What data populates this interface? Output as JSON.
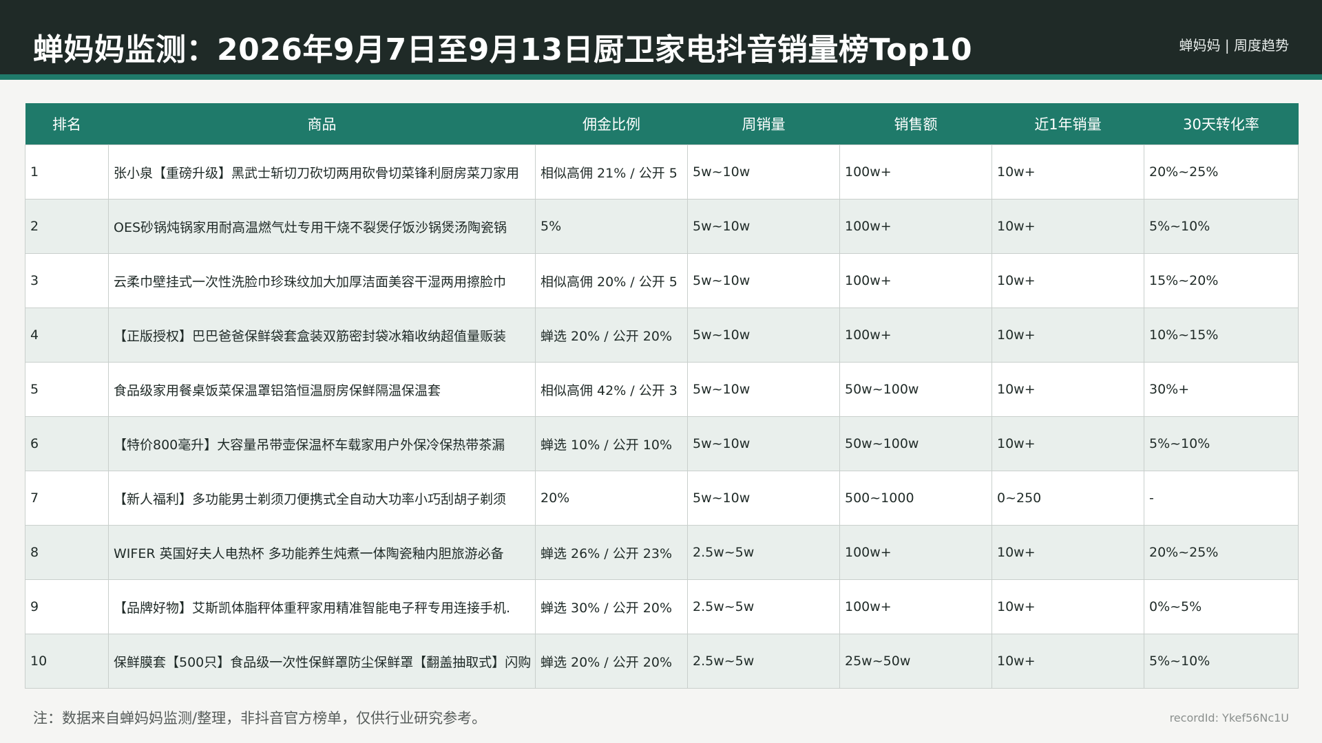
{
  "header": {
    "title": "蝉妈妈监测：2026年9月7日至9月13日厨卫家电抖音销量榜Top10",
    "brand": "蝉妈妈 | 周度趋势"
  },
  "table": {
    "columns": [
      "排名",
      "商品",
      "佣金比例",
      "周销量",
      "销售额",
      "近1年销量",
      "30天转化率"
    ],
    "rows": [
      {
        "rank": "1",
        "product": "张小泉【重磅升级】黑武士斩切刀砍切两用砍骨切菜锋利厨房菜刀家用",
        "commission": "相似高佣 21% / 公开 5",
        "weekly_sales": "5w~10w",
        "revenue": "100w+",
        "yearly_sales": "10w+",
        "conversion": "20%~25%"
      },
      {
        "rank": "2",
        "product": "OES砂锅炖锅家用耐高温燃气灶专用干烧不裂煲仔饭沙锅煲汤陶瓷锅",
        "commission": "5%",
        "weekly_sales": "5w~10w",
        "revenue": "100w+",
        "yearly_sales": "10w+",
        "conversion": "5%~10%"
      },
      {
        "rank": "3",
        "product": "云柔巾壁挂式一次性洗脸巾珍珠纹加大加厚洁面美容干湿两用擦脸巾",
        "commission": "相似高佣 20% / 公开 5",
        "weekly_sales": "5w~10w",
        "revenue": "100w+",
        "yearly_sales": "10w+",
        "conversion": "15%~20%"
      },
      {
        "rank": "4",
        "product": "【正版授权】巴巴爸爸保鲜袋套盒装双筋密封袋冰箱收纳超值量贩装",
        "commission": "蝉选 20% / 公开 20%",
        "weekly_sales": "5w~10w",
        "revenue": "100w+",
        "yearly_sales": "10w+",
        "conversion": "10%~15%"
      },
      {
        "rank": "5",
        "product": "食品级家用餐桌饭菜保温罩铝箔恒温厨房保鲜隔温保温套",
        "commission": "相似高佣 42% / 公开 3",
        "weekly_sales": "5w~10w",
        "revenue": "50w~100w",
        "yearly_sales": "10w+",
        "conversion": "30%+"
      },
      {
        "rank": "6",
        "product": "【特价800毫升】大容量吊带壶保温杯车载家用户外保冷保热带茶漏",
        "commission": "蝉选 10% / 公开 10%",
        "weekly_sales": "5w~10w",
        "revenue": "50w~100w",
        "yearly_sales": "10w+",
        "conversion": "5%~10%"
      },
      {
        "rank": "7",
        "product": "【新人福利】多功能男士剃须刀便携式全自动大功率小巧刮胡子剃须",
        "commission": "20%",
        "weekly_sales": "5w~10w",
        "revenue": "500~1000",
        "yearly_sales": "0~250",
        "conversion": "-"
      },
      {
        "rank": "8",
        "product": "WIFER 英国好夫人电热杯 多功能养生炖煮一体陶瓷釉内胆旅游必备",
        "commission": "蝉选 26% / 公开 23%",
        "weekly_sales": "2.5w~5w",
        "revenue": "100w+",
        "yearly_sales": "10w+",
        "conversion": "20%~25%"
      },
      {
        "rank": "9",
        "product": "【品牌好物】艾斯凯体脂秤体重秤家用精准智能电子秤专用连接手机.",
        "commission": "蝉选 30% / 公开 20%",
        "weekly_sales": "2.5w~5w",
        "revenue": "100w+",
        "yearly_sales": "10w+",
        "conversion": "0%~5%"
      },
      {
        "rank": "10",
        "product": "保鲜膜套【500只】食品级一次性保鲜罩防尘保鲜罩【翻盖抽取式】闪购",
        "commission": "蝉选 20% / 公开 20%",
        "weekly_sales": "2.5w~5w",
        "revenue": "25w~50w",
        "yearly_sales": "10w+",
        "conversion": "5%~10%"
      }
    ]
  },
  "footer": {
    "note": "注：数据来自蝉妈妈监测/整理，非抖音官方榜单，仅供行业研究参考。",
    "record_id": "recordId: Ykef56Nc1U"
  }
}
